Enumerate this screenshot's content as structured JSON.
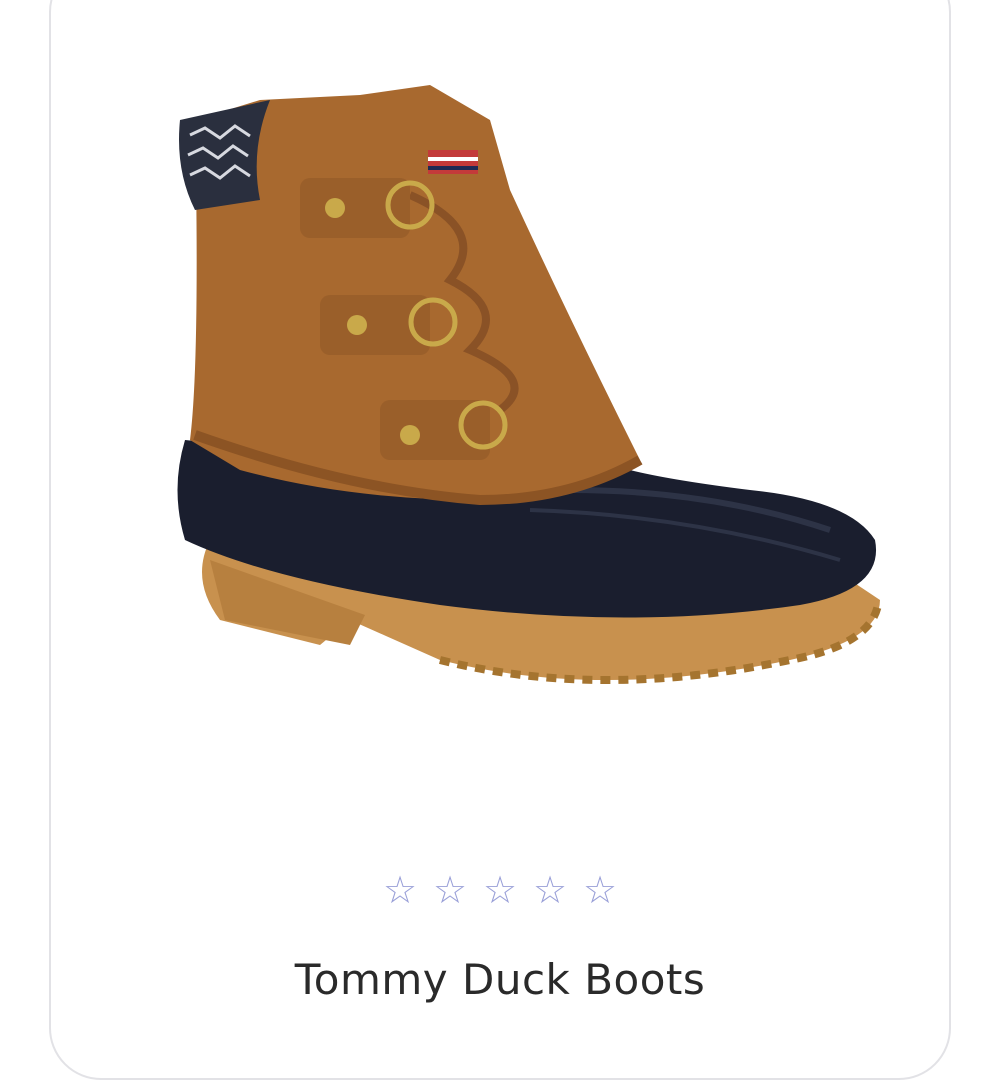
{
  "product": {
    "title": "Tommy Duck Boots",
    "image_icon": "boot-image",
    "rating": {
      "stars": [
        "☆",
        "☆",
        "☆",
        "☆",
        "☆"
      ],
      "value": 0,
      "max": 5,
      "star_color": "#9aa0d8"
    },
    "colors": {
      "upper": "#a8692f",
      "rubber": "#1a1e2e",
      "sole": "#c8914e",
      "eyelet": "#c9a94a"
    }
  }
}
